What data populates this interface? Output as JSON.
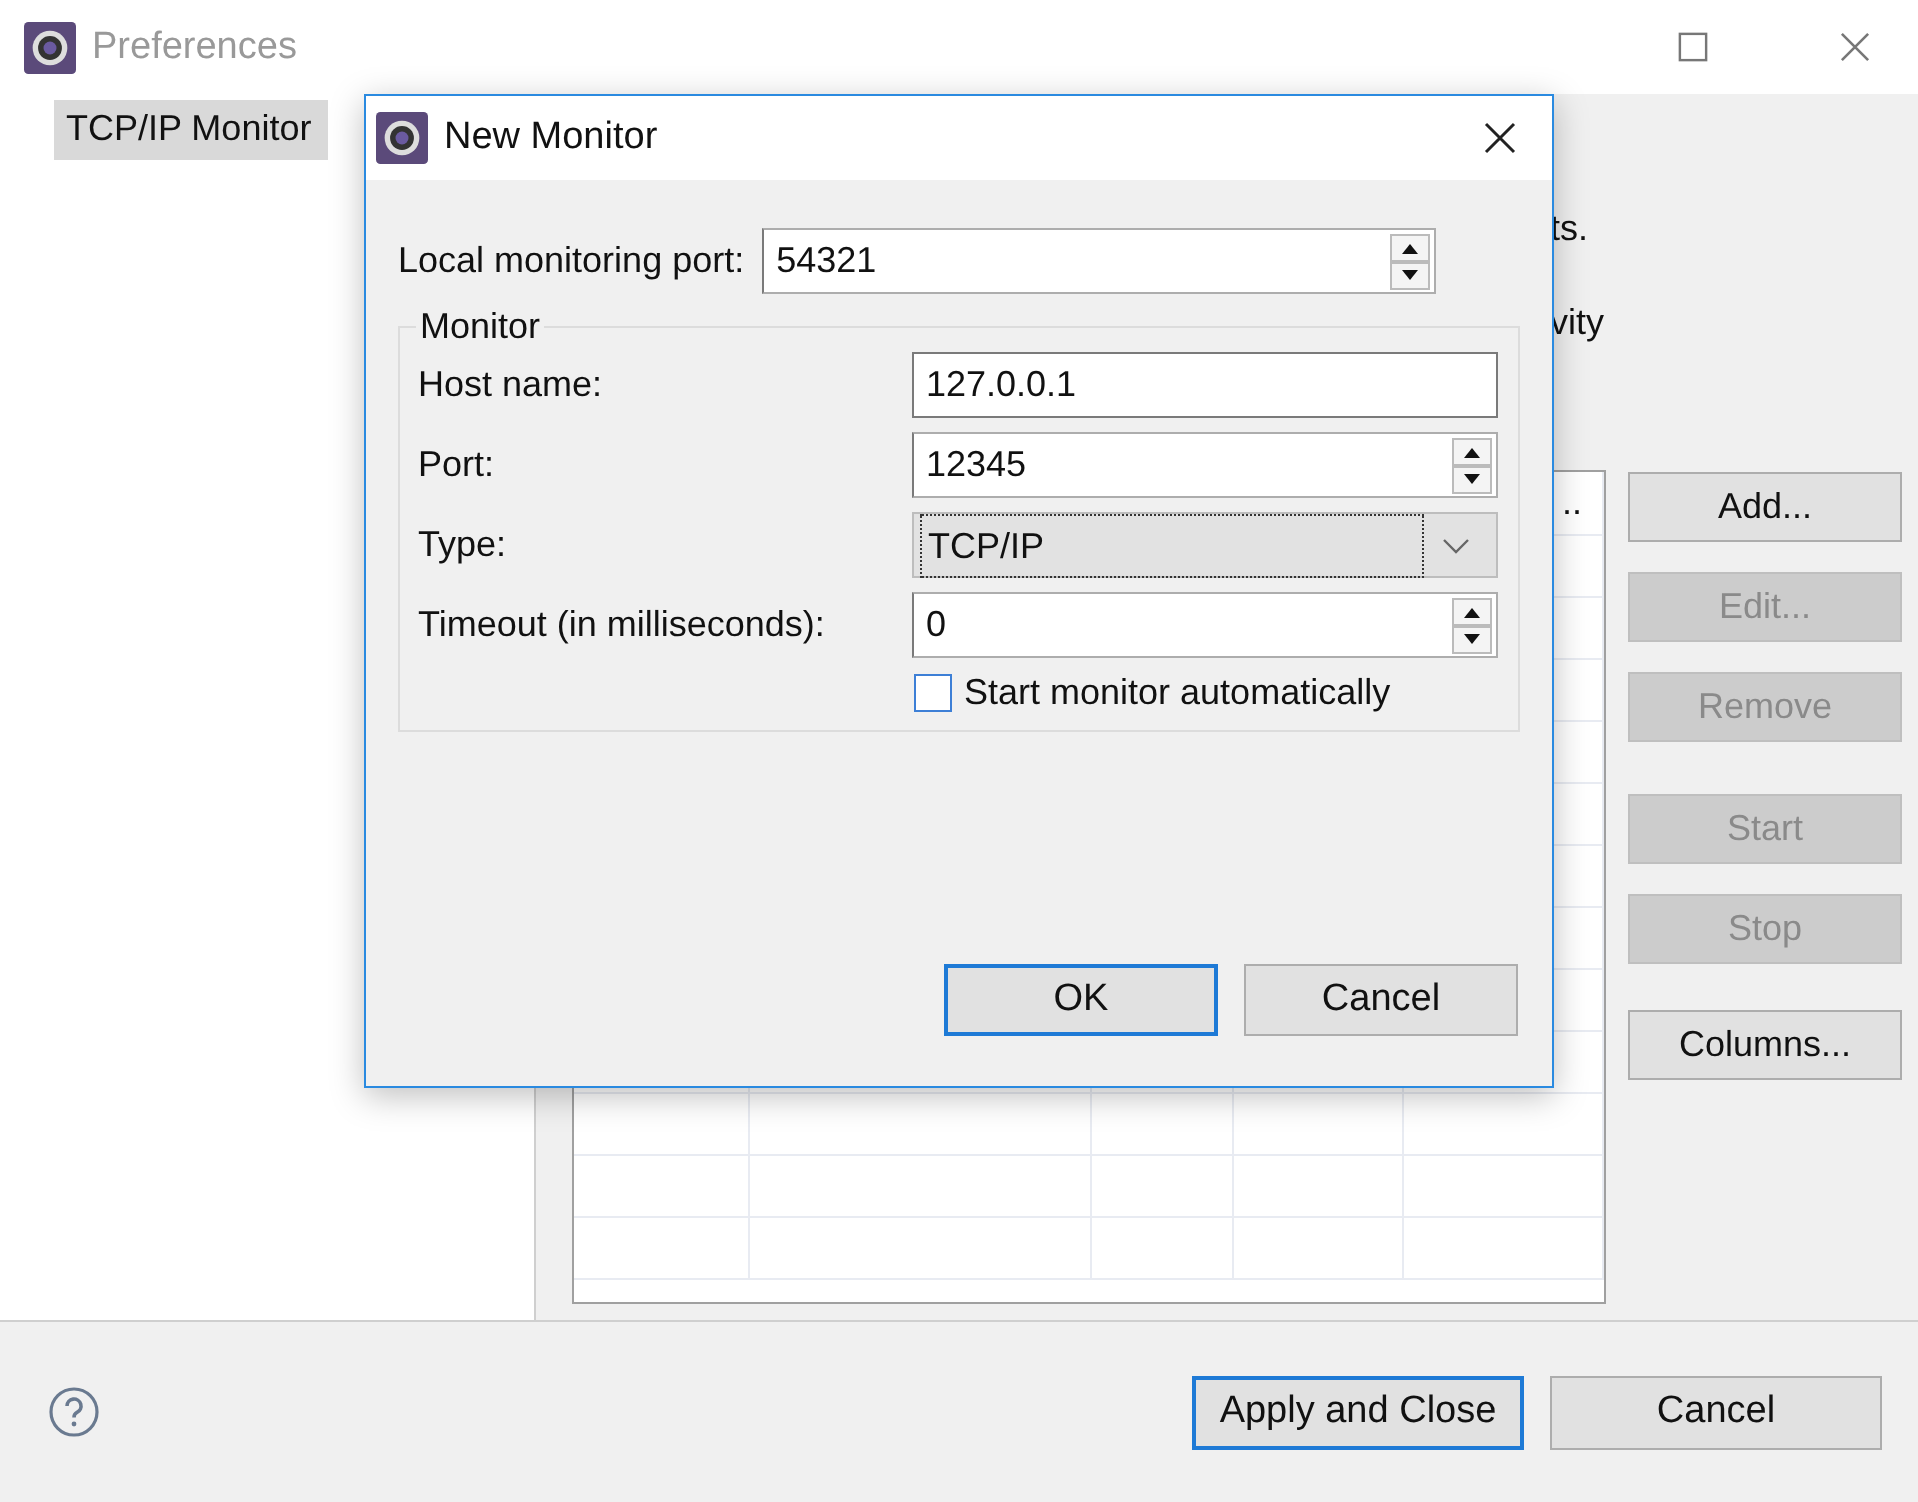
{
  "window": {
    "title": "Preferences"
  },
  "sidebar": {
    "items": [
      {
        "label": "TCP/IP Monitor",
        "selected": true
      }
    ]
  },
  "page": {
    "text_lines": [
      "ts.",
      "vity"
    ],
    "table": {
      "header_fragment": ".."
    },
    "buttons": [
      {
        "label": "Add...",
        "disabled": false
      },
      {
        "label": "Edit...",
        "disabled": true
      },
      {
        "label": "Remove",
        "disabled": true
      },
      {
        "label": "Start",
        "disabled": true
      },
      {
        "label": "Stop",
        "disabled": true
      },
      {
        "label": "Columns...",
        "disabled": false
      }
    ]
  },
  "footer": {
    "buttons": [
      {
        "label": "Apply and Close",
        "default": true
      },
      {
        "label": "Cancel",
        "default": false
      }
    ]
  },
  "dialog": {
    "title": "New Monitor",
    "local_port": {
      "label": "Local monitoring port:",
      "value": "54321"
    },
    "group": {
      "title": "Monitor",
      "fields": [
        {
          "kind": "text",
          "label": "Host name:",
          "value": "127.0.0.1"
        },
        {
          "kind": "spinner",
          "label": "Port:",
          "value": "12345"
        },
        {
          "kind": "combo",
          "label": "Type:",
          "value": "TCP/IP"
        },
        {
          "kind": "spinner",
          "label": "Timeout (in milliseconds):",
          "value": "0"
        }
      ],
      "checkbox": {
        "label": "Start monitor automatically",
        "checked": false
      }
    },
    "buttons": [
      {
        "label": "OK",
        "default": true
      },
      {
        "label": "Cancel",
        "default": false
      }
    ]
  }
}
